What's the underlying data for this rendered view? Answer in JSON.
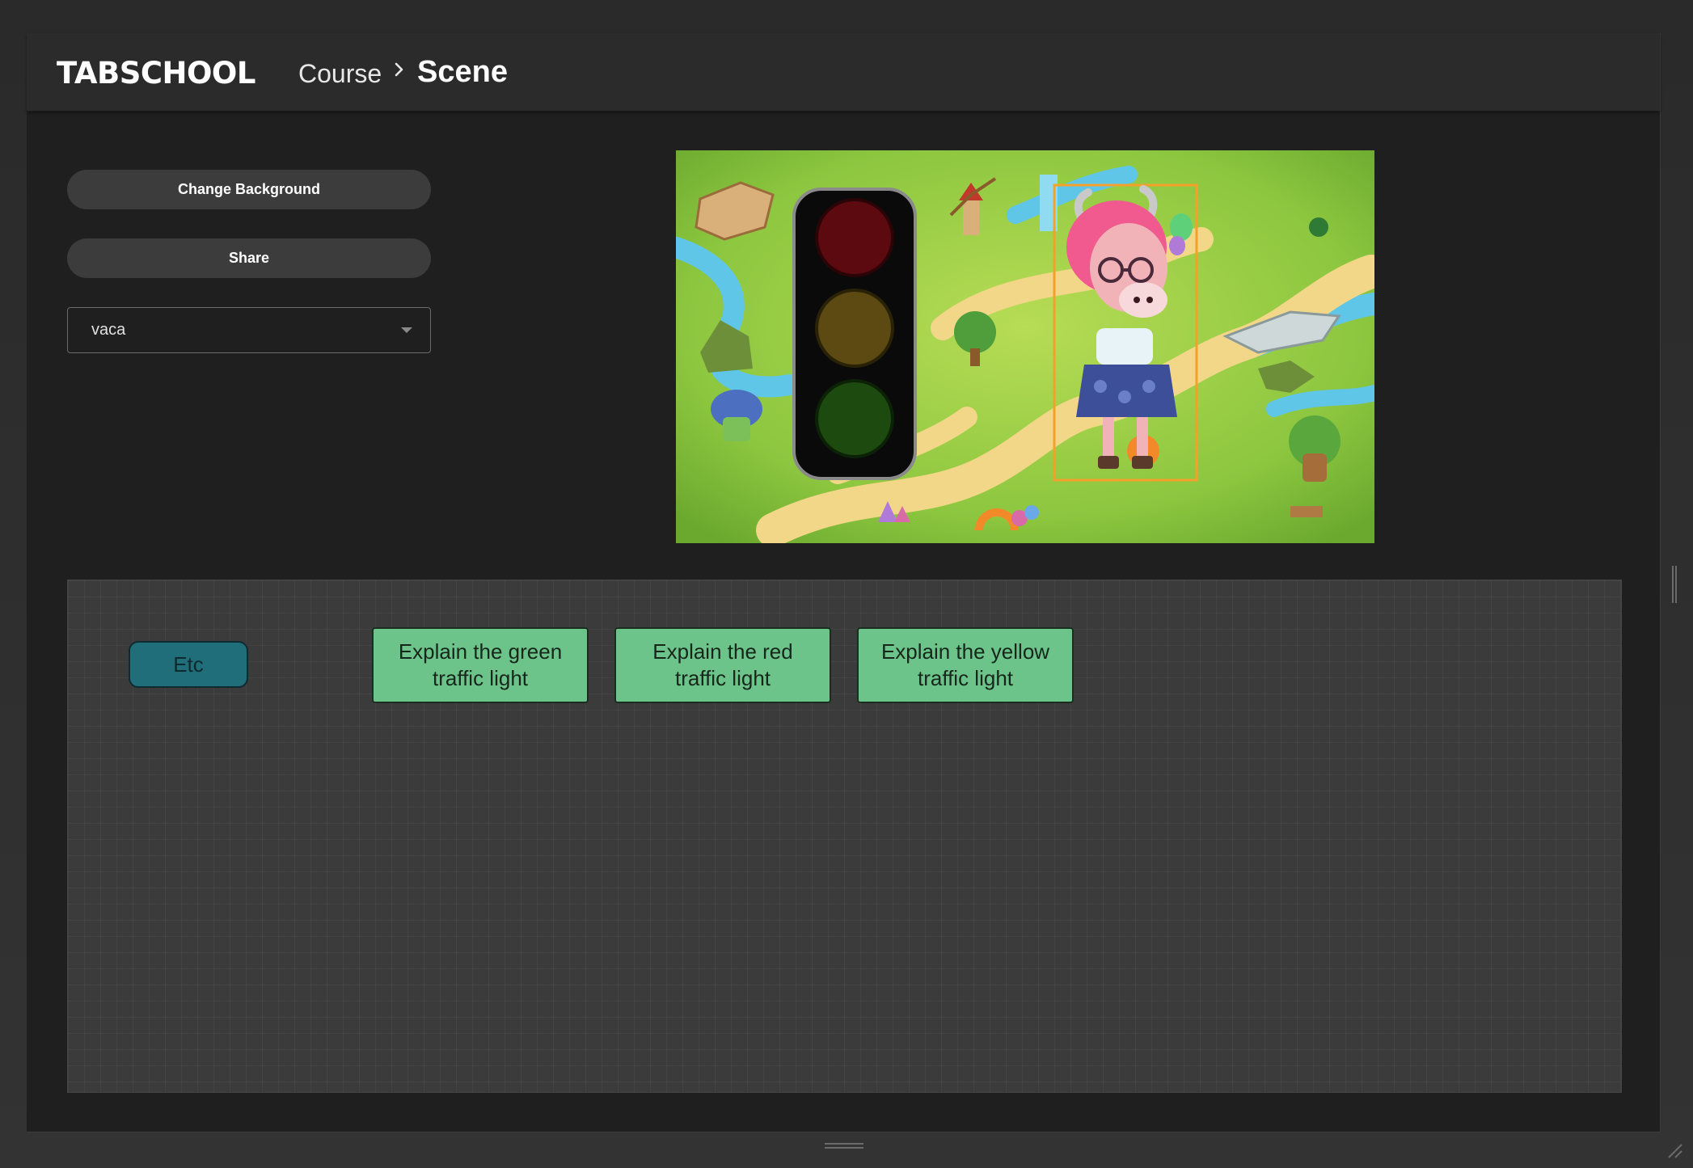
{
  "header": {
    "logo": "TABSCHOOL",
    "breadcrumb": {
      "parent": "Course",
      "current": "Scene"
    }
  },
  "sidebar": {
    "change_background_label": "Change Background",
    "share_label": "Share",
    "character_select": {
      "value": "vaca"
    }
  },
  "scene": {
    "icons": [
      "traffic-light-icon",
      "cow-teacher-character"
    ],
    "traffic_light": {
      "lights": [
        "red",
        "yellow",
        "green"
      ]
    }
  },
  "flow_canvas": {
    "nodes": [
      {
        "label": "Etc",
        "color": "#1f6e7a"
      },
      {
        "label": "Explain the green traffic light",
        "color": "#6cc48a"
      },
      {
        "label": "Explain the red traffic light",
        "color": "#6cc48a"
      },
      {
        "label": "Explain the yellow traffic light",
        "color": "#6cc48a"
      }
    ]
  },
  "colors": {
    "background": "#1f1f1f",
    "header": "#2b2b2b",
    "button": "#3c3c3c",
    "selection_box": "#f4a02a"
  }
}
